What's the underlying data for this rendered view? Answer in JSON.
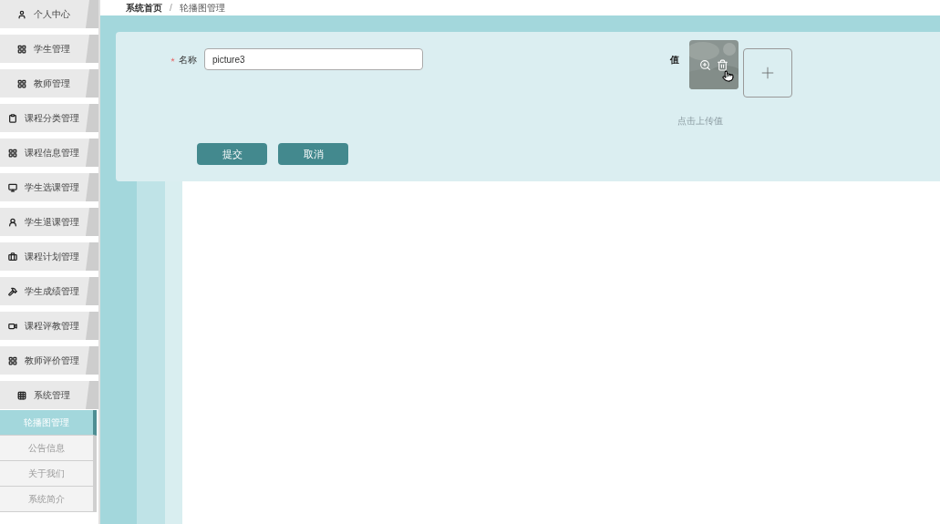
{
  "breadcrumb": [
    "系统首页",
    "/",
    "轮播图管理"
  ],
  "sidebar": {
    "items": [
      {
        "label": "个人中心"
      },
      {
        "label": "学生管理"
      },
      {
        "label": "教师管理"
      },
      {
        "label": "课程分类管理"
      },
      {
        "label": "课程信息管理"
      },
      {
        "label": "学生选课管理"
      },
      {
        "label": "学生退课管理"
      },
      {
        "label": "课程计划管理"
      },
      {
        "label": "学生成绩管理"
      },
      {
        "label": "课程评教管理"
      },
      {
        "label": "教师评价管理"
      },
      {
        "label": "系统管理",
        "children": [
          {
            "label": "轮播图管理",
            "selected": true
          },
          {
            "label": "公告信息",
            "selected": false
          },
          {
            "label": "关于我们",
            "selected": false
          },
          {
            "label": "系统简介",
            "selected": false
          }
        ]
      }
    ]
  },
  "form": {
    "name_field": {
      "label": "名称",
      "required": true,
      "value": "picture3"
    },
    "value_field": {
      "label": "值",
      "hint": "点击上传值"
    },
    "buttons": [
      "提交",
      "取消"
    ]
  }
}
